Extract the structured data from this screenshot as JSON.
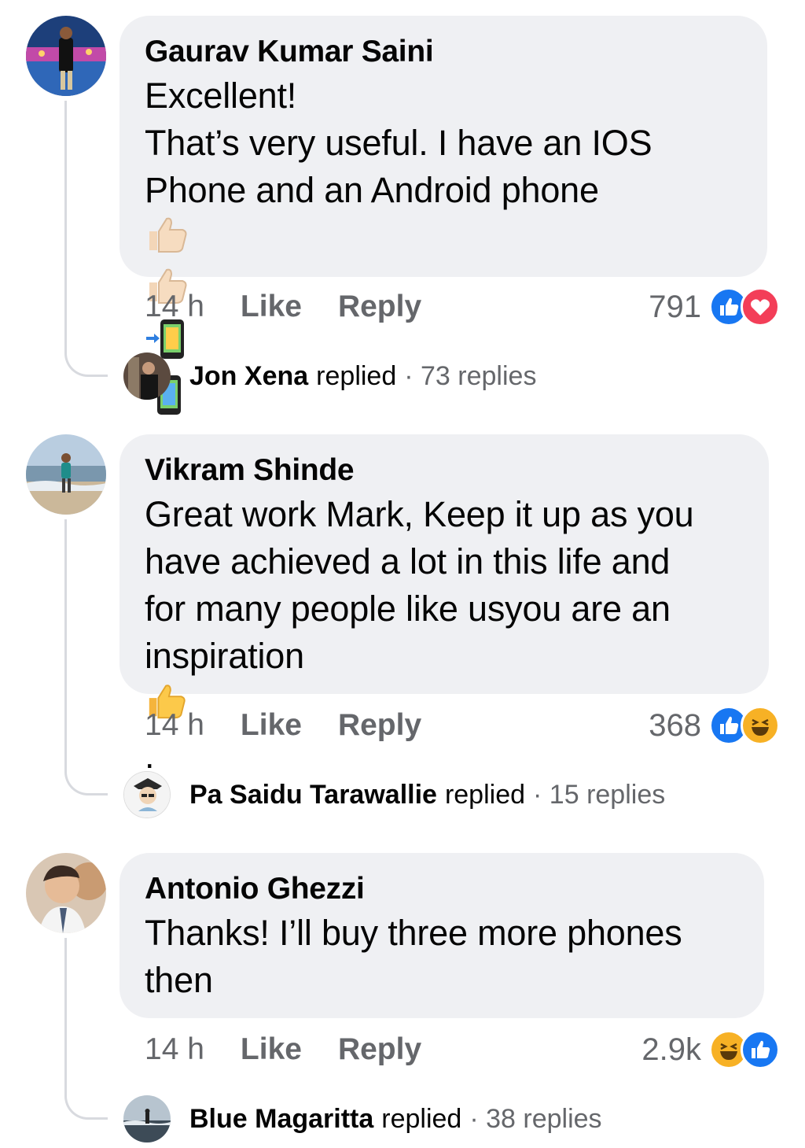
{
  "comments": [
    {
      "author": "Gaurav Kumar Saini",
      "lines": [
        "Excellent!",
        "That’s very useful.  I have an IOS",
        "Phone and an Android phone"
      ],
      "time": "14 h",
      "like_label": "Like",
      "reply_label": "Reply",
      "reaction_count": "791",
      "reactions": [
        "like-icon",
        "love-icon"
      ],
      "reply_summary": {
        "name": "Jon Xena",
        "verb": "replied",
        "count": "· 73 replies"
      }
    },
    {
      "author": "Vikram Shinde",
      "lines": [
        "Great work Mark, Keep it up as you",
        "have achieved a lot in this life and",
        "for many people like  usyou are an",
        "inspiration"
      ],
      "trailing": ".",
      "time": "14 h",
      "like_label": "Like",
      "reply_label": "Reply",
      "reaction_count": "368",
      "reactions": [
        "like-icon",
        "haha-icon"
      ],
      "reply_summary": {
        "name": "Pa Saidu Tarawallie",
        "verb": "replied",
        "count": "· 15 replies"
      }
    },
    {
      "author": "Antonio Ghezzi",
      "lines": [
        "Thanks! I’ll buy three more phones",
        "then"
      ],
      "time": "14 h",
      "like_label": "Like",
      "reply_label": "Reply",
      "reaction_count": "2.9k",
      "reactions": [
        "haha-icon",
        "like-icon"
      ],
      "reply_summary": {
        "name": "Blue Magaritta",
        "verb": "replied",
        "count": "· 38 replies"
      }
    }
  ],
  "colors": {
    "bubble": "#eff0f3",
    "secondary_text": "#65676b",
    "like": "#1877f2",
    "love": "#f33e58",
    "haha": "#f7b125"
  }
}
